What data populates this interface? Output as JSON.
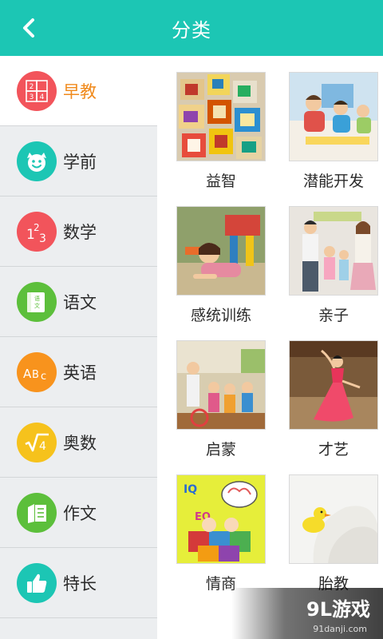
{
  "header": {
    "title": "分类",
    "back_icon": "chevron-left-icon",
    "bg_color": "#1cc6b4"
  },
  "sidebar": {
    "active_color": "#f08a1c",
    "items": [
      {
        "label": "早教",
        "icon": "number-grid-icon",
        "color": "#f2545b",
        "active": true
      },
      {
        "label": "学前",
        "icon": "smiley-face-icon",
        "color": "#1cc6b4",
        "active": false
      },
      {
        "label": "数学",
        "icon": "numbers-123-icon",
        "color": "#f2545b",
        "active": false
      },
      {
        "label": "语文",
        "icon": "book-icon",
        "color": "#5cbf3b",
        "active": false
      },
      {
        "label": "英语",
        "icon": "abc-icon",
        "color": "#f8931d",
        "active": false
      },
      {
        "label": "奥数",
        "icon": "square-root-icon",
        "color": "#f6c21c",
        "active": false
      },
      {
        "label": "作文",
        "icon": "notebook-icon",
        "color": "#5cbf3b",
        "active": false
      },
      {
        "label": "特长",
        "icon": "thumbs-up-icon",
        "color": "#1cc6b4",
        "active": false
      }
    ]
  },
  "categories": [
    {
      "label": "益智",
      "image": "alphabet-blocks-photo"
    },
    {
      "label": "潜能开发",
      "image": "kids-drawing-photo"
    },
    {
      "label": "感统训练",
      "image": "girl-crawling-photo"
    },
    {
      "label": "亲子",
      "image": "family-photo"
    },
    {
      "label": "启蒙",
      "image": "classroom-photo"
    },
    {
      "label": "才艺",
      "image": "dancer-photo"
    },
    {
      "label": "情商",
      "image": "iq-eq-cartoon"
    },
    {
      "label": "胎教",
      "image": "pregnant-duck-photo"
    }
  ],
  "watermark": {
    "main": "9L游戏",
    "sub": "91danji.com"
  }
}
